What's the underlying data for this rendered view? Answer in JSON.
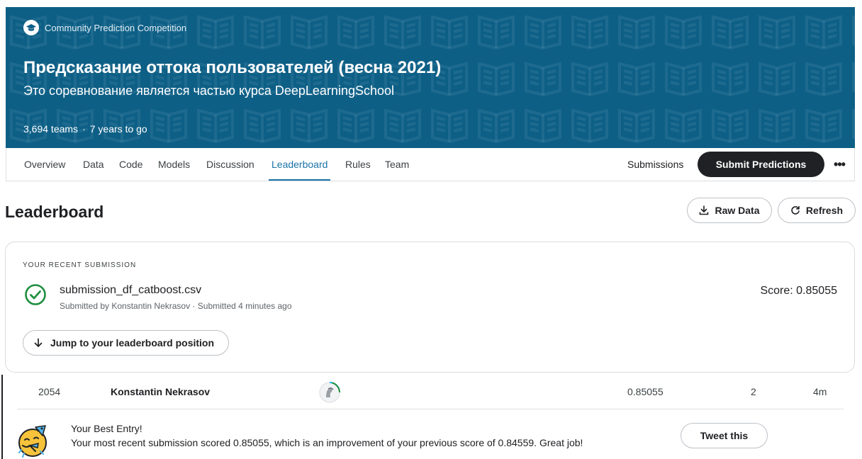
{
  "hero": {
    "kicker": "Community Prediction Competition",
    "title": "Предсказание оттока пользователей (весна 2021)",
    "subtitle": "Это соревнование является частью курса DeepLearningSchool",
    "teams": "3,694 teams",
    "separator": "·",
    "time_left": "7 years to go",
    "background_color": "#0d5f86"
  },
  "tabs": [
    {
      "label": "Overview",
      "active": false
    },
    {
      "label": "Data",
      "active": false
    },
    {
      "label": "Code",
      "active": false
    },
    {
      "label": "Models",
      "active": false
    },
    {
      "label": "Discussion",
      "active": false
    },
    {
      "label": "Leaderboard",
      "active": true
    },
    {
      "label": "Rules",
      "active": false
    },
    {
      "label": "Team",
      "active": false
    }
  ],
  "tabbar": {
    "submissions_label": "Submissions",
    "submit_label": "Submit Predictions",
    "more_label": "•••"
  },
  "page": {
    "title": "Leaderboard",
    "raw_data_label": "Raw Data",
    "refresh_label": "Refresh"
  },
  "recent_submission": {
    "kicker": "YOUR RECENT SUBMISSION",
    "file_name": "submission_df_catboost.csv",
    "meta": "Submitted by Konstantin Nekrasov · Submitted 4 minutes ago",
    "score": "Score: 0.85055",
    "jump_label": "Jump to your leaderboard position",
    "status_color": "#1e8e3e"
  },
  "leaderboard_row": {
    "rank": "2054",
    "team_name": "Konstantin Nekrasov",
    "score": "0.85055",
    "entries": "2",
    "last": "4m"
  },
  "best_entry": {
    "title": "Your Best Entry!",
    "message": "Your most recent submission scored 0.85055, which is an improvement of your previous score of 0.84559. Great job!",
    "tweet_label": "Tweet this"
  },
  "icons": [
    "graduation-cap-icon",
    "download-icon",
    "refresh-icon",
    "check-circle-icon",
    "arrow-down-icon",
    "user-avatar",
    "party-face-icon",
    "more-icon"
  ]
}
